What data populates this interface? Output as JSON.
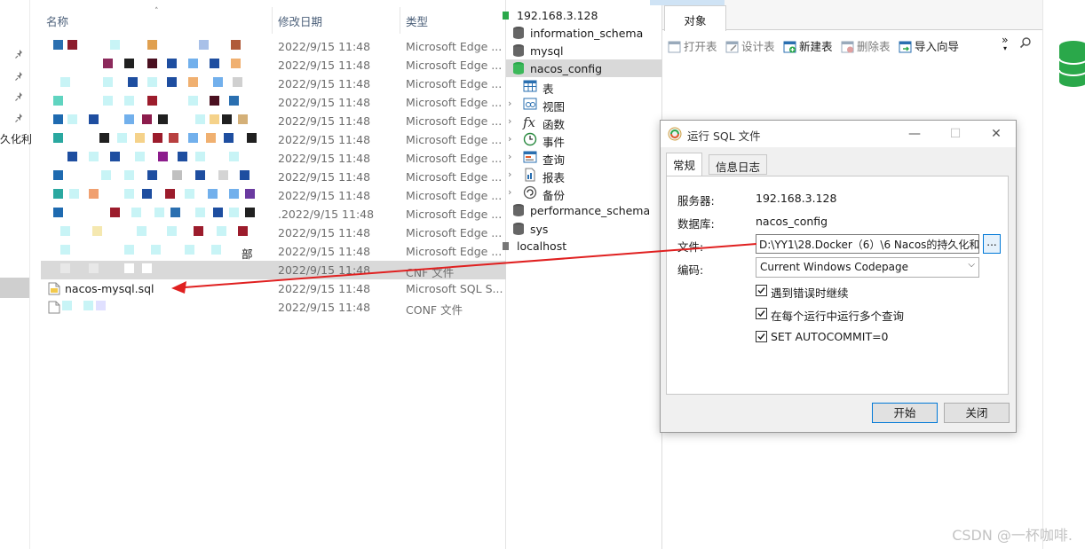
{
  "explorer": {
    "columns": {
      "name": "名称",
      "date": "修改日期",
      "type": "类型"
    },
    "nav_label": "久化利",
    "rows": [
      {
        "date": "2022/9/15 11:48",
        "type": "Microsoft Edge ..."
      },
      {
        "date": "2022/9/15 11:48",
        "type": "Microsoft Edge ..."
      },
      {
        "date": "2022/9/15 11:48",
        "type": "Microsoft Edge ..."
      },
      {
        "date": "2022/9/15 11:48",
        "type": "Microsoft Edge ..."
      },
      {
        "date": "2022/9/15 11:48",
        "type": "Microsoft Edge ..."
      },
      {
        "date": "2022/9/15 11:48",
        "type": "Microsoft Edge ..."
      },
      {
        "date": "2022/9/15 11:48",
        "type": "Microsoft Edge ..."
      },
      {
        "date": "2022/9/15 11:48",
        "type": "Microsoft Edge ..."
      },
      {
        "date": "2022/9/15 11:48",
        "type": "Microsoft Edge ..."
      },
      {
        "date": "2022/9/15 11:48",
        "type": "Microsoft Edge ..."
      },
      {
        "date": "2022/9/15 11:48",
        "type": "Microsoft Edge ..."
      },
      {
        "date": "2022/9/15 11:48",
        "type": "Microsoft Edge ..."
      },
      {
        "date": "2022/9/15 11:48",
        "type": "CNF 文件"
      },
      {
        "name": "nacos-mysql.sql",
        "date": "2022/9/15 11:48",
        "type": "Microsoft SQL S..."
      },
      {
        "date": "2022/9/15 11:48",
        "type": "CONF 文件"
      }
    ],
    "row_partial_text": {
      "row9": ".",
      "row10": "2",
      "row11": "-",
      "row12": "部"
    }
  },
  "tree": {
    "connection": "192.168.3.128",
    "databases": [
      "information_schema",
      "mysql",
      "nacos_config"
    ],
    "nodes": [
      "表",
      "视图",
      "函数",
      "事件",
      "查询",
      "报表",
      "备份"
    ],
    "more_databases": [
      "performance_schema",
      "sys"
    ],
    "localhost": "localhost",
    "selected": "nacos_config"
  },
  "objects": {
    "tab": "对象",
    "toolbar": {
      "open": "打开表",
      "design": "设计表",
      "new": "新建表",
      "delete": "删除表",
      "import": "导入向导",
      "more": "»"
    }
  },
  "dialog": {
    "title": "运行 SQL 文件",
    "tabs": [
      "常规",
      "信息日志"
    ],
    "server_label": "服务器:",
    "server_value": "192.168.3.128",
    "database_label": "数据库:",
    "database_value": "nacos_config",
    "file_label": "文件:",
    "file_value": "D:\\YY1\\28.Docker（6）\\6 Nacos的持久化和",
    "browse": "...",
    "encoding_label": "编码:",
    "encoding_value": "Current Windows Codepage",
    "checks": [
      {
        "label": "遇到错误时继续",
        "checked": true
      },
      {
        "label": "在每个运行中运行多个查询",
        "checked": true
      },
      {
        "label": "SET AUTOCOMMIT=0",
        "checked": true
      }
    ],
    "start": "开始",
    "close": "关闭"
  },
  "watermark": "CSDN @一杯咖啡.",
  "colors": {
    "accent": "#0078d7",
    "arrow": "#e02020",
    "db_green": "#2aa84a"
  }
}
